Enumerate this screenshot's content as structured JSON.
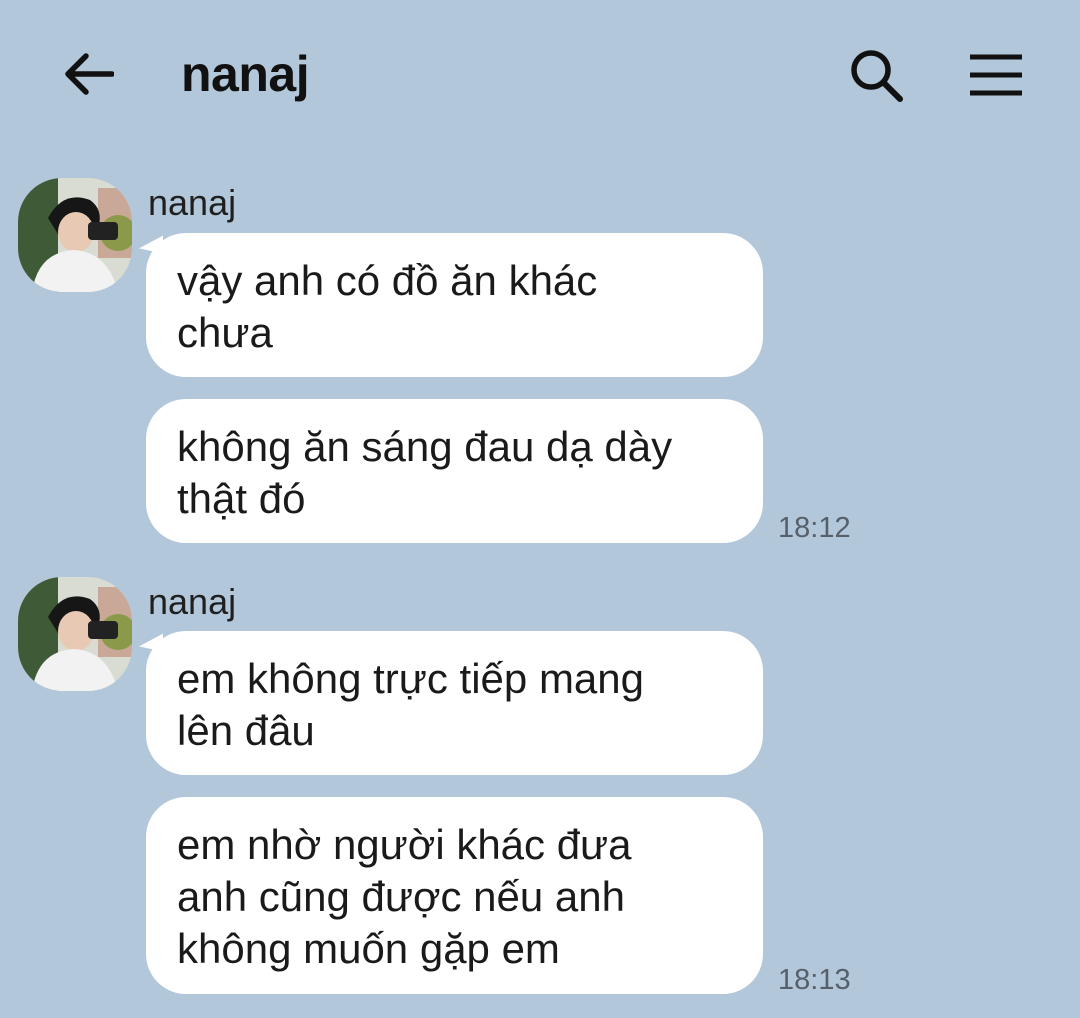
{
  "header": {
    "title": "nanaj"
  },
  "messages": {
    "group1": {
      "sender": "nanaj",
      "bubble1": [
        "vậy anh có đồ ăn khác",
        "chưa"
      ],
      "bubble2": [
        "không ăn sáng đau dạ dày",
        "thật đó"
      ],
      "time": "18:12"
    },
    "group2": {
      "sender": "nanaj",
      "bubble1": [
        "em không trực tiếp mang",
        "lên đâu"
      ],
      "bubble2": [
        "em nhờ người khác đưa",
        "anh cũng được nếu anh",
        "không muốn gặp em"
      ],
      "time": "18:13"
    }
  },
  "icons": {
    "back": "arrow-left-icon",
    "search": "search-icon",
    "menu": "hamburger-menu-icon"
  },
  "colors": {
    "background": "#b2c7da",
    "bubble": "#ffffff",
    "timestamp": "#56606a"
  }
}
